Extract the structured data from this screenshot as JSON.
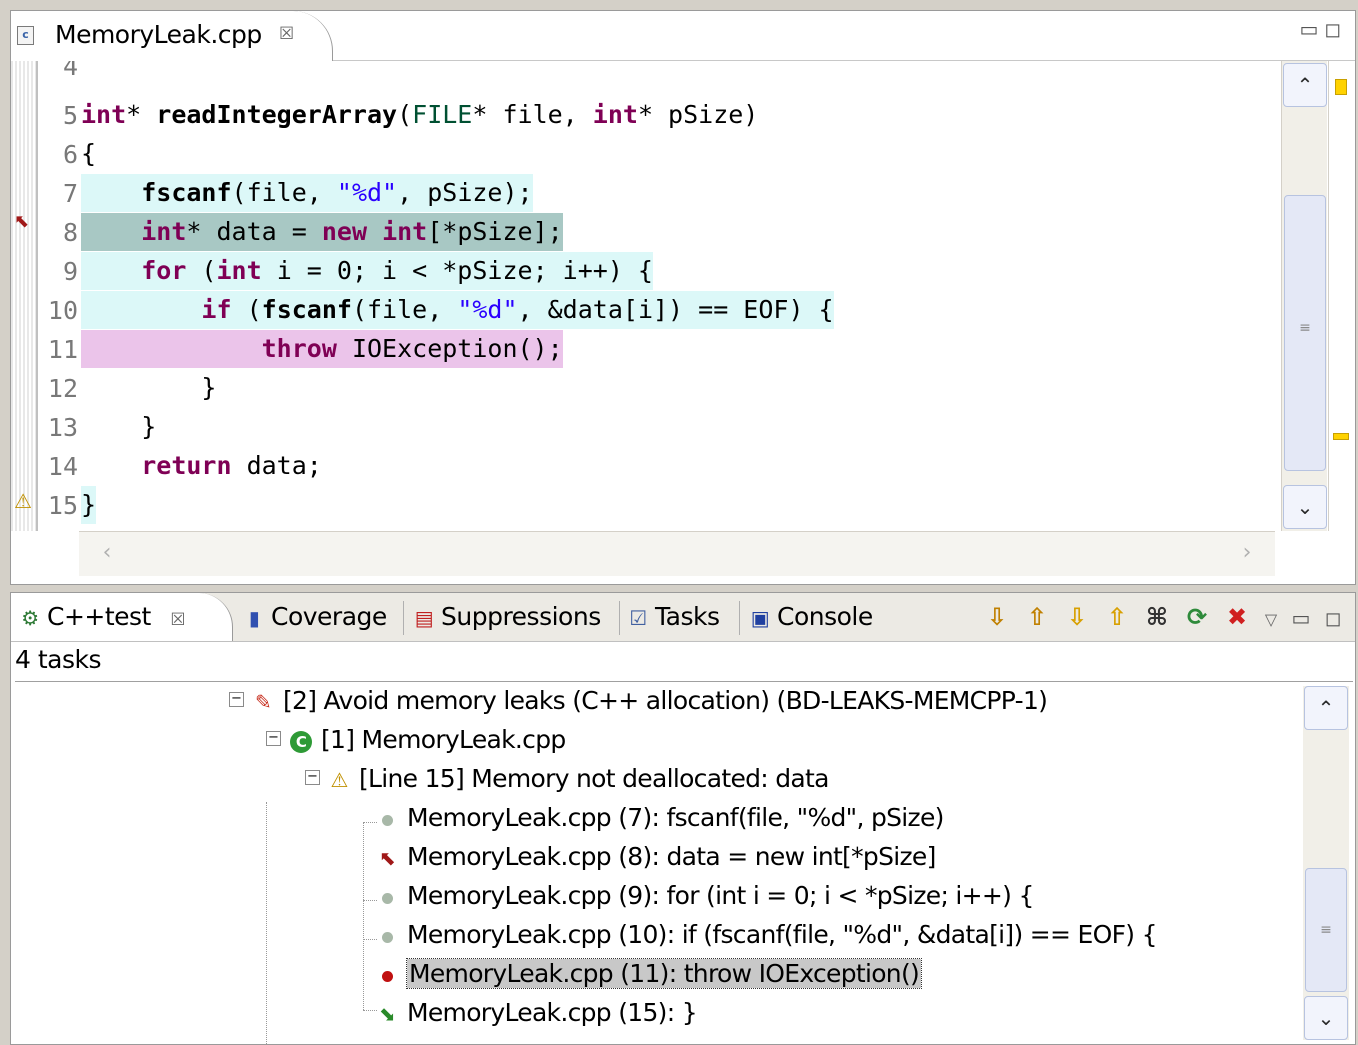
{
  "editor": {
    "tab_title": "MemoryLeak.cpp",
    "close_glyph": "☒",
    "window_buttons": "▭ ◻",
    "line_numbers": [
      "4",
      "5",
      "6",
      "7",
      "8",
      "9",
      "10",
      "11",
      "12",
      "13",
      "14",
      "15"
    ],
    "highlight_colors": {
      "trace": "#dcf8f8",
      "allocation": "#a8c8c4",
      "throw": "#ebc4ea"
    }
  },
  "bottom_view": {
    "tabs": [
      {
        "label": "C++test",
        "icon": "c++test-icon",
        "active": true
      },
      {
        "label": "Coverage",
        "icon": "coverage-bars-icon"
      },
      {
        "label": "Suppressions",
        "icon": "suppressions-icon"
      },
      {
        "label": "Tasks",
        "icon": "tasks-icon"
      },
      {
        "label": "Console",
        "icon": "console-icon"
      }
    ],
    "close_glyph": "☒",
    "summary": "4 tasks",
    "tree": {
      "rule": "[2] Avoid memory leaks (C++ allocation) (BD-LEAKS-MEMCPP-1)",
      "file": "[1] MemoryLeak.cpp",
      "violation": "[Line 15] Memory not deallocated: data",
      "trace": [
        {
          "text": "MemoryLeak.cpp (7): fscanf(file, \"%d\", pSize)",
          "icon": "gray-dot-icon"
        },
        {
          "text": "MemoryLeak.cpp (8): data = new int[*pSize]",
          "icon": "allocation-arrow-icon"
        },
        {
          "text": "MemoryLeak.cpp (9): for (int i = 0; i < *pSize; i++) {",
          "icon": "gray-dot-icon"
        },
        {
          "text": "MemoryLeak.cpp (10): if (fscanf(file, \"%d\", &data[i]) == EOF) {",
          "icon": "gray-dot-icon"
        },
        {
          "text": "MemoryLeak.cpp (11): throw IOException()",
          "icon": "red-dot-icon",
          "selected": true
        },
        {
          "text": "MemoryLeak.cpp (15): }",
          "icon": "exit-arrow-icon"
        }
      ]
    }
  }
}
